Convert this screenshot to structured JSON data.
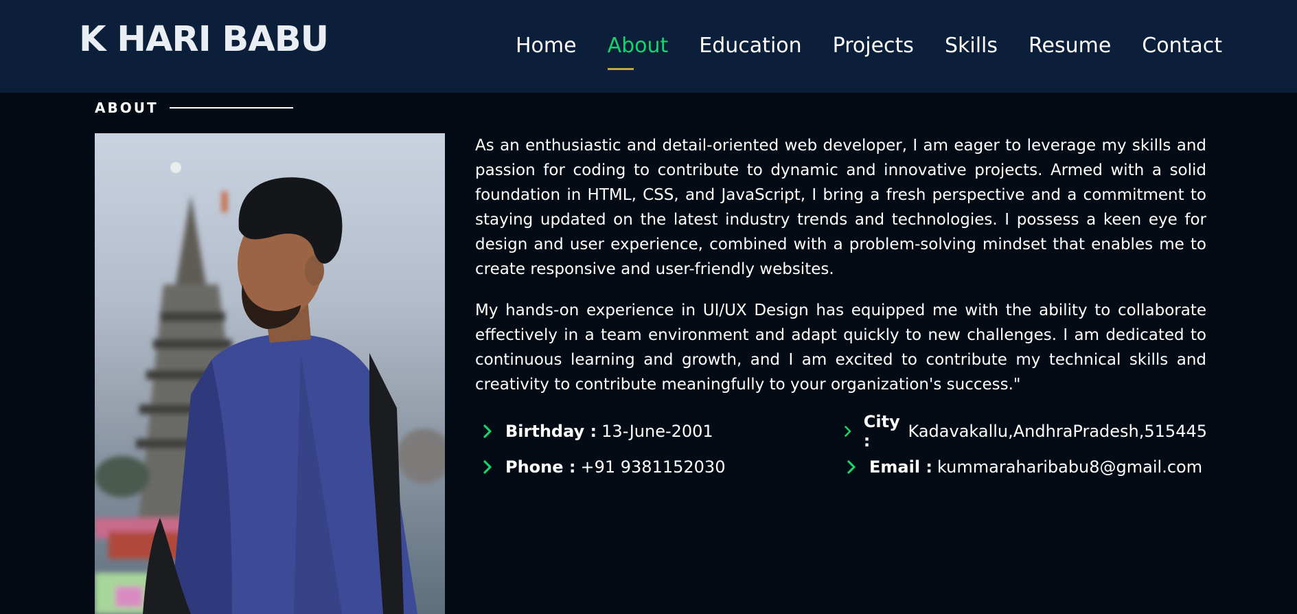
{
  "header": {
    "logo": "K HARI BABU",
    "nav": [
      "Home",
      "About",
      "Education",
      "Projects",
      "Skills",
      "Resume",
      "Contact"
    ],
    "active_nav": "About"
  },
  "about": {
    "section_title": "ABOUT",
    "paragraphs": [
      "As an enthusiastic and detail-oriented web developer, I am eager to leverage my skills and passion for coding to contribute to dynamic and innovative projects. Armed with a solid foundation in HTML, CSS, and JavaScript, I bring a fresh perspective and a commitment to staying updated on the latest industry trends and technologies. I possess a keen eye for design and user experience, combined with a problem-solving mindset that enables me to create responsive and user-friendly websites.",
      "My hands-on experience in UI/UX Design has equipped me with the ability to collaborate effectively in a team environment and adapt quickly to new challenges. I am dedicated to continuous learning and growth, and I am excited to contribute my technical skills and creativity to contribute meaningfully to your organization's success.\""
    ],
    "details": [
      {
        "label": "Birthday :",
        "value": "13-June-2001"
      },
      {
        "label": "City :",
        "value": "Kadavakallu,AndhraPradesh,515445"
      },
      {
        "label": "Phone :",
        "value": "+91 9381152030"
      },
      {
        "label": "Email :",
        "value": "kummaraharibabu8@gmail.com"
      }
    ]
  },
  "colors": {
    "header_bg": "#0b1e3a",
    "page_bg": "#040b14",
    "accent": "#18d26e",
    "underline": "#c6a54b"
  },
  "icons": {
    "detail_bullet": "chevron-right-icon"
  }
}
